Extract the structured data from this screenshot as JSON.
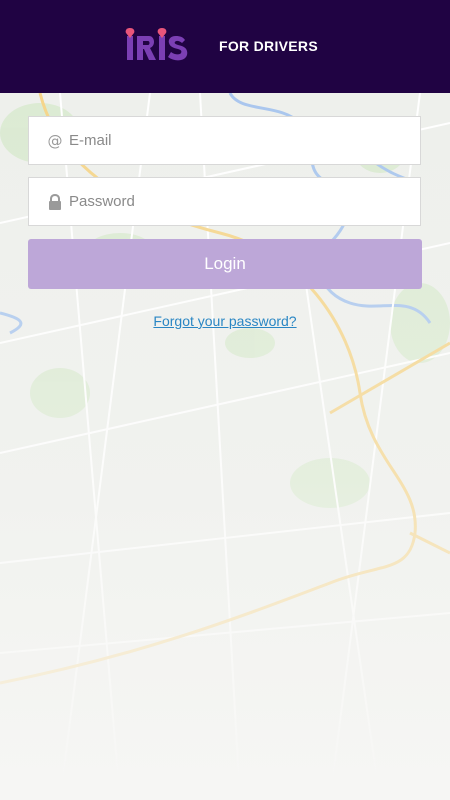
{
  "header": {
    "logo_text": "IRIS",
    "tagline": "FOR DRIVERS",
    "background_color": "#200343",
    "logo_color": "#7b3fb4",
    "marker_color": "#e8557a"
  },
  "form": {
    "email": {
      "placeholder": "E-mail",
      "value": "",
      "icon": "at-icon"
    },
    "password": {
      "placeholder": "Password",
      "value": "",
      "icon": "lock-icon"
    },
    "login_label": "Login",
    "login_color": "#bda7d8",
    "forgot_label": "Forgot your password?",
    "forgot_color": "#2a86c4"
  },
  "background": {
    "type": "map"
  }
}
